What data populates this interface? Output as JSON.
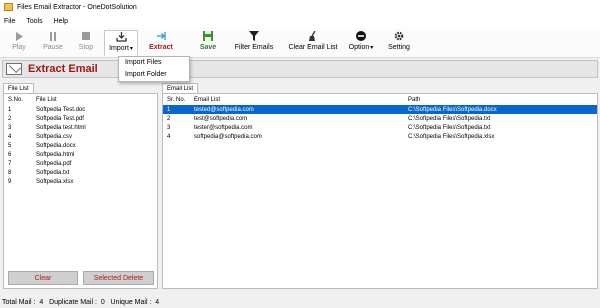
{
  "app": {
    "title": "Files Email Extractor - OneDotSolution"
  },
  "menu": [
    "File",
    "Tools",
    "Help"
  ],
  "toolbar": {
    "play": "Play",
    "pause": "Pause",
    "stop": "Stop",
    "import": "Import",
    "extract": "Extract",
    "save": "Save",
    "filter": "Filter Emails",
    "clear_list": "Clear Email List",
    "option": "Option",
    "setting": "Setting"
  },
  "import_menu": [
    "Import Files",
    "Import Folder"
  ],
  "banner": {
    "title": "Extract Email"
  },
  "file_list": {
    "tab": "File List",
    "headers": {
      "sr": "S.No.",
      "file": "File List"
    },
    "rows": [
      {
        "sr": "1",
        "file": "Softpedia Test.doc"
      },
      {
        "sr": "2",
        "file": "Softpedia Test.pdf"
      },
      {
        "sr": "3",
        "file": "Softpedia test.html"
      },
      {
        "sr": "4",
        "file": "Softpedia.csv"
      },
      {
        "sr": "5",
        "file": "Softpedia.docx"
      },
      {
        "sr": "6",
        "file": "Softpedia.html"
      },
      {
        "sr": "7",
        "file": "Softpedia.pdf"
      },
      {
        "sr": "8",
        "file": "Softpedia.txt"
      },
      {
        "sr": "9",
        "file": "Softpedia.xlsx"
      }
    ],
    "clear_button": "Clear",
    "selected_delete_button": "Selected Delete"
  },
  "email_list": {
    "tab": "Email List",
    "headers": {
      "sr": "Sr. No.",
      "email": "Email List",
      "path": "Path"
    },
    "rows": [
      {
        "sr": "1",
        "email": "tested@softpedia.com",
        "path": "C:\\Softpedia Files\\Softpedia.docx"
      },
      {
        "sr": "2",
        "email": "test@softpedia.com",
        "path": "C:\\Softpedia Files\\Softpedia.txt"
      },
      {
        "sr": "3",
        "email": "tester@softpedia.com",
        "path": "C:\\Softpedia Files\\Softpedia.txt"
      },
      {
        "sr": "4",
        "email": "softpedia@softpedia.com",
        "path": "C:\\Softpedia Files\\Softpedia.xlsx"
      }
    ]
  },
  "status": {
    "text": "Total Mail :  4   Duplicate Mail :  0   Unique Mail :  4"
  },
  "colors": {
    "brand_red": "#b01818",
    "save_green": "#2b7a25",
    "selection_blue": "#0a66cc"
  }
}
